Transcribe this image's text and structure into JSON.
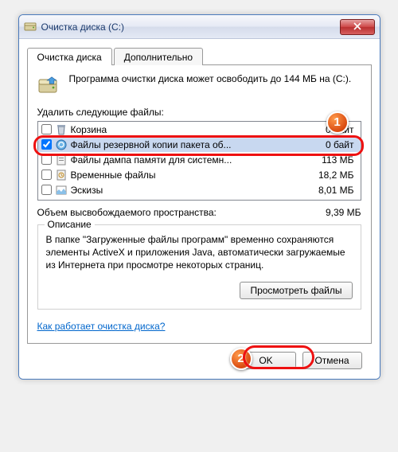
{
  "window": {
    "title": "Очистка диска  (C:)"
  },
  "tabs": {
    "main": "Очистка диска",
    "more": "Дополнительно"
  },
  "intro": "Программа очистки диска может освободить до 144 МБ на  (C:).",
  "labels": {
    "delete": "Удалить следующие файлы:",
    "total": "Объем высвобождаемого пространства:",
    "description": "Описание"
  },
  "files": [
    {
      "name": "Корзина",
      "size": "0 байт",
      "checked": false
    },
    {
      "name": "Файлы резервной копии пакета об...",
      "size": "0 байт",
      "checked": true,
      "selected": true
    },
    {
      "name": "Файлы дампа памяти для системн...",
      "size": "113 МБ",
      "checked": false
    },
    {
      "name": "Временные файлы",
      "size": "18,2 МБ",
      "checked": false
    },
    {
      "name": "Эскизы",
      "size": "8,01 МБ",
      "checked": false
    }
  ],
  "total_value": "9,39 МБ",
  "description": "В папке \"Загруженные файлы программ\" временно сохраняются элементы ActiveX и приложения Java, автоматически загружаемые из Интернета при просмотре некоторых страниц.",
  "buttons": {
    "view": "Просмотреть файлы",
    "ok": "OK",
    "cancel": "Отмена"
  },
  "link": "Как работает очистка диска?",
  "badges": {
    "one": "1",
    "two": "2"
  }
}
